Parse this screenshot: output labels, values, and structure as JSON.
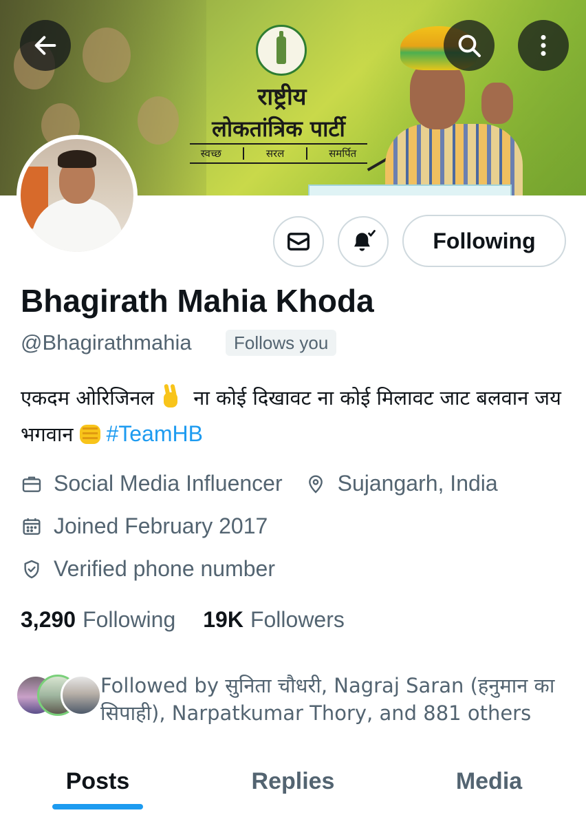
{
  "banner": {
    "party_line1": "राष्ट्रीय",
    "party_line2": "लोकतांत्रिक पार्टी",
    "tag1": "स्वच्छ",
    "tag2": "सरल",
    "tag3": "समर्पित"
  },
  "header": {
    "back_icon": "arrow-left-icon",
    "search_icon": "search-icon",
    "more_icon": "more-vertical-icon"
  },
  "actions": {
    "message_icon": "envelope-icon",
    "notify_icon": "bell-check-icon",
    "following_label": "Following"
  },
  "profile": {
    "name": "Bhagirath Mahia Khoda",
    "handle": "@Bhagirathmahia",
    "follows_you": "Follows you",
    "bio_part1": "एकदम ओरिजिनल",
    "bio_part2": " ना कोई दिखावट  ना कोई मिलावट  जाट बलवान जय भगवान",
    "hashtag": "#TeamHB",
    "category": "Social Media Influencer",
    "location": "Sujangarh, India",
    "joined": "Joined February 2017",
    "verified": "Verified phone number"
  },
  "stats": {
    "following_count": "3,290",
    "following_label": "Following",
    "followers_count": "19K",
    "followers_label": "Followers"
  },
  "followed_by": {
    "text": "Followed by सुनिता चौधरी, Nagraj Saran (हनुमान का सिपाही), Narpatkumar Thory, and 881 others"
  },
  "tabs": [
    {
      "label": "Posts",
      "active": true
    },
    {
      "label": "Replies",
      "active": false
    },
    {
      "label": "Media",
      "active": false
    }
  ],
  "colors": {
    "accent": "#1d9bf0",
    "text_primary": "#0f1419",
    "text_secondary": "#536471",
    "border": "#cfd9de"
  }
}
